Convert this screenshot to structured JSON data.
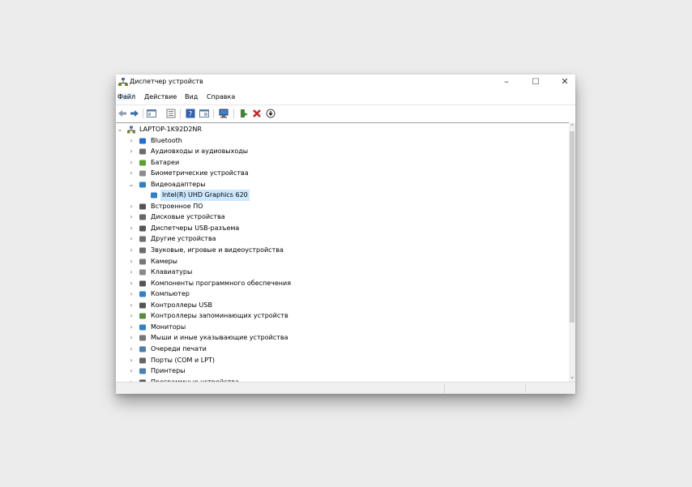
{
  "window": {
    "title": "Диспетчер устройств",
    "controls": {
      "minimize": "–",
      "maximize": "☐",
      "close": "✕"
    }
  },
  "menu": [
    {
      "label": "Файл",
      "active": true
    },
    {
      "label": "Действие"
    },
    {
      "label": "Вид"
    },
    {
      "label": "Справка"
    }
  ],
  "toolbar": [
    "back-icon",
    "forward-icon",
    "show-hide-console-tree-icon",
    "properties-icon",
    "help-icon",
    "properties-sheet-icon",
    "scan-hardware-icon",
    "add-driver-icon",
    "uninstall-device-icon",
    "update-driver-icon"
  ],
  "tree": {
    "root": "LAPTOP-1K92D2NR",
    "items": [
      {
        "label": "Bluetooth",
        "icon": "bluetooth-icon"
      },
      {
        "label": "Аудиовходы и аудиовыходы",
        "icon": "speaker-icon"
      },
      {
        "label": "Батареи",
        "icon": "battery-icon"
      },
      {
        "label": "Биометрические устройства",
        "icon": "biometric-icon"
      },
      {
        "label": "Видеоадаптеры",
        "icon": "display-adapter-icon",
        "expanded": true,
        "children": [
          {
            "label": "Intel(R) UHD Graphics 620",
            "icon": "display-adapter-icon",
            "selected": true
          }
        ]
      },
      {
        "label": "Встроенное ПО",
        "icon": "firmware-icon"
      },
      {
        "label": "Дисковые устройства",
        "icon": "disk-drive-icon"
      },
      {
        "label": "Диспетчеры USB-разъема",
        "icon": "usb-connector-icon"
      },
      {
        "label": "Другие устройства",
        "icon": "unknown-device-icon"
      },
      {
        "label": "Звуковые, игровые и видеоустройства",
        "icon": "sound-icon"
      },
      {
        "label": "Камеры",
        "icon": "camera-icon"
      },
      {
        "label": "Клавиатуры",
        "icon": "keyboard-icon"
      },
      {
        "label": "Компоненты программного обеспечения",
        "icon": "software-component-icon"
      },
      {
        "label": "Компьютер",
        "icon": "computer-icon"
      },
      {
        "label": "Контроллеры USB",
        "icon": "usb-icon"
      },
      {
        "label": "Контроллеры запоминающих устройств",
        "icon": "storage-controller-icon"
      },
      {
        "label": "Мониторы",
        "icon": "monitor-icon"
      },
      {
        "label": "Мыши и иные указывающие устройства",
        "icon": "mouse-icon"
      },
      {
        "label": "Очереди печати",
        "icon": "print-queue-icon"
      },
      {
        "label": "Порты (COM и LPT)",
        "icon": "port-icon"
      },
      {
        "label": "Принтеры",
        "icon": "printer-icon"
      },
      {
        "label": "Программные устройства",
        "icon": "software-device-icon"
      }
    ]
  }
}
